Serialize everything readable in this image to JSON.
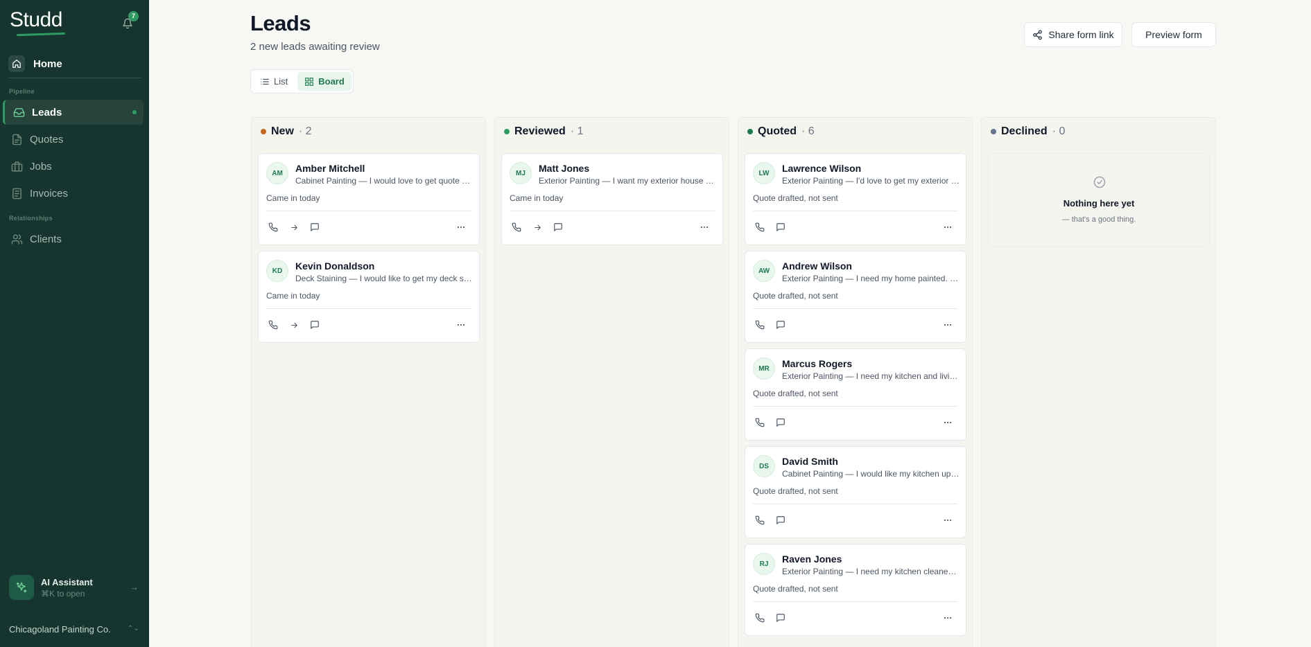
{
  "app": {
    "brand": "Studd",
    "notification_count": "7"
  },
  "sidebar": {
    "home": "Home",
    "section_pipeline": "Pipeline",
    "section_relationships": "Relationships",
    "items": [
      {
        "label": "Leads",
        "icon": "inbox-icon",
        "active": true
      },
      {
        "label": "Quotes",
        "icon": "document-icon",
        "active": false
      },
      {
        "label": "Jobs",
        "icon": "briefcase-icon",
        "active": false
      },
      {
        "label": "Invoices",
        "icon": "invoice-icon",
        "active": false
      },
      {
        "label": "Clients",
        "icon": "users-icon",
        "active": false
      }
    ],
    "ai_title": "AI Assistant",
    "ai_shortcut": "⌘K to open",
    "organization": "Chicagoland Painting Co."
  },
  "header": {
    "title": "Leads",
    "subtitle": "2 new leads awaiting review",
    "share_button": "Share form link",
    "preview_button": "Preview form"
  },
  "view_toggle": {
    "list": "List",
    "board": "Board",
    "selected": "Board"
  },
  "columns": [
    {
      "name": "New",
      "count": "· 2",
      "color": "#c2671c",
      "cards": [
        {
          "initials": "AM",
          "name": "Amber Mitchell",
          "desc": "Cabinet Painting — I would love to get quote on my kitchen cabinets",
          "status": "Came in today"
        },
        {
          "initials": "KD",
          "name": "Kevin Donaldson",
          "desc": "Deck Staining — I would like to get my deck stained this summer",
          "status": "Came in today"
        }
      ]
    },
    {
      "name": "Reviewed",
      "count": "· 1",
      "color": "#2f9b63",
      "cards": [
        {
          "initials": "MJ",
          "name": "Matt Jones",
          "desc": "Exterior Painting — I want my exterior house painted this spring",
          "status": "Came in today"
        }
      ]
    },
    {
      "name": "Quoted",
      "count": "· 6",
      "color": "#1e7a4c",
      "cards": [
        {
          "initials": "LW",
          "name": "Lawrence Wilson",
          "desc": "Exterior Painting — I'd love to get my exterior painted",
          "status": "Quote drafted, not sent"
        },
        {
          "initials": "AW",
          "name": "Andrew Wilson",
          "desc": "Exterior Painting — I need my home painted. It has been years",
          "status": "Quote drafted, not sent"
        },
        {
          "initials": "MR",
          "name": "Marcus Rogers",
          "desc": "Exterior Painting — I need my kitchen and living room painted",
          "status": "Quote drafted, not sent"
        },
        {
          "initials": "DS",
          "name": "David Smith",
          "desc": "Cabinet Painting — I would like my kitchen updated with new colors",
          "status": "Quote drafted, not sent"
        },
        {
          "initials": "RJ",
          "name": "Raven Jones",
          "desc": "Exterior Painting — I need my kitchen cleaned up and painted",
          "status": "Quote drafted, not sent"
        }
      ]
    },
    {
      "name": "Declined",
      "count": "· 0",
      "color": "#64748b",
      "empty_title": "Nothing here yet",
      "empty_sub": "— that's a good thing."
    }
  ]
}
